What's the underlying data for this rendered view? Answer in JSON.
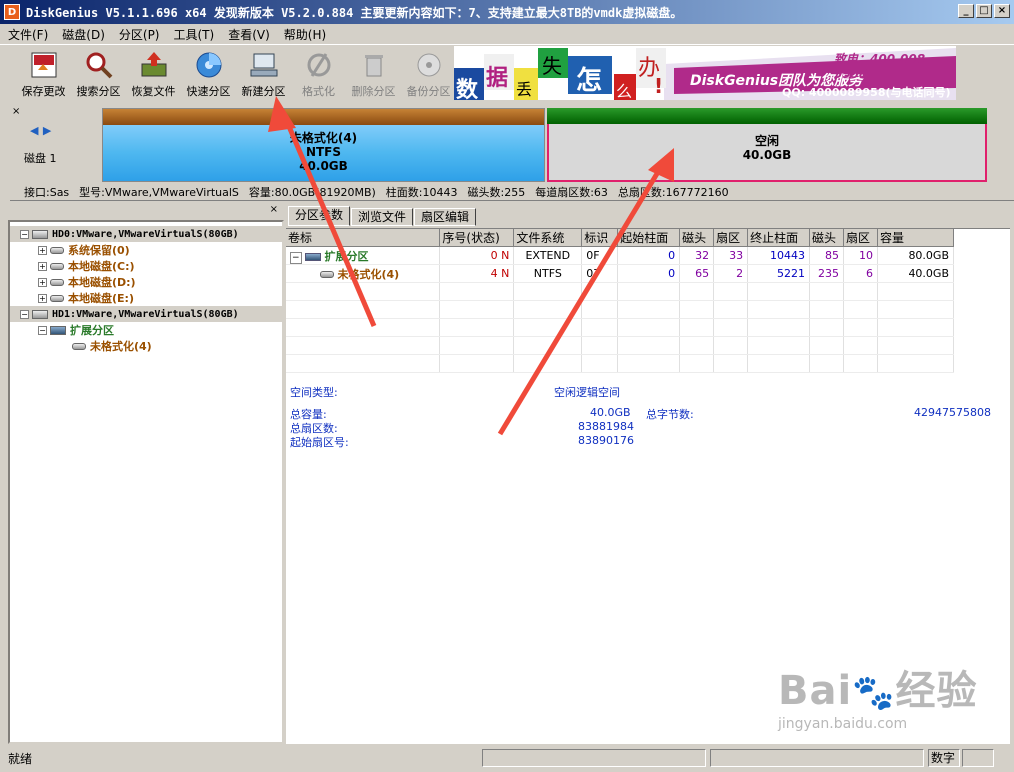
{
  "window": {
    "app_icon": "D",
    "title": "DiskGenius V5.1.1.696 x64   发现新版本 V5.2.0.884 主要更新内容如下：7、支持建立最大8TB的vmdk虚拟磁盘。",
    "buttons": [
      "_",
      "□",
      "×"
    ]
  },
  "menu": [
    "文件(F)",
    "磁盘(D)",
    "分区(P)",
    "工具(T)",
    "查看(V)",
    "帮助(H)"
  ],
  "toolbar": {
    "buttons": [
      {
        "label": "保存更改",
        "icon": "save-icon",
        "enabled": true
      },
      {
        "label": "搜索分区",
        "icon": "search-icon",
        "enabled": true
      },
      {
        "label": "恢复文件",
        "icon": "recover-icon",
        "enabled": true
      },
      {
        "label": "快速分区",
        "icon": "quick-partition-icon",
        "enabled": true
      },
      {
        "label": "新建分区",
        "icon": "new-partition-icon",
        "enabled": true
      },
      {
        "label": "格式化",
        "icon": "format-icon",
        "enabled": false
      },
      {
        "label": "删除分区",
        "icon": "trash-icon",
        "enabled": false
      },
      {
        "label": "备份分区",
        "icon": "backup-icon",
        "enabled": false
      }
    ]
  },
  "banner": {
    "chars": [
      "数",
      "据",
      "丢",
      "失",
      "怎",
      "么",
      "办"
    ],
    "exclaim": "!",
    "brand": "DiskGenius团队为您服务",
    "phone": "致电：400-008-9958",
    "qq": "QQ: 4000089958(与电话同号)"
  },
  "diskmap": {
    "close": "×",
    "disk_label": "磁盘 1",
    "nav_left": "◀",
    "nav_right": "▶",
    "part1": {
      "name": "未格式化(4)",
      "fs": "NTFS",
      "size": "40.0GB"
    },
    "part2": {
      "name": "空闲",
      "size": "40.0GB"
    }
  },
  "infobar": {
    "interface": "接口:Sas",
    "model": "型号:VMware,VMwareVirtualS",
    "capacity": "容量:80.0GB(81920MB)",
    "cylinders": "柱面数:10443",
    "heads": "磁头数:255",
    "sectors_per_track": "每道扇区数:63",
    "total_sectors": "总扇区数:167772160"
  },
  "tree": {
    "close": "×",
    "nodes": [
      {
        "level": 0,
        "toggle": "−",
        "label": "HD0:VMware,VMwareVirtualS(80GB)",
        "color": "black"
      },
      {
        "level": 1,
        "toggle": "+",
        "label": "系统保留(0)",
        "color": "brown"
      },
      {
        "level": 1,
        "toggle": "+",
        "label": "本地磁盘(C:)",
        "color": "brown"
      },
      {
        "level": 1,
        "toggle": "+",
        "label": "本地磁盘(D:)",
        "color": "brown"
      },
      {
        "level": 1,
        "toggle": "+",
        "label": "本地磁盘(E:)",
        "color": "brown"
      },
      {
        "level": 0,
        "toggle": "−",
        "label": "HD1:VMware,VMwareVirtualS(80GB)",
        "color": "black"
      },
      {
        "level": 1,
        "toggle": "−",
        "label": "扩展分区",
        "color": "green"
      },
      {
        "level": 2,
        "toggle": "",
        "label": "未格式化(4)",
        "color": "brown"
      }
    ]
  },
  "tabs": [
    "分区参数",
    "浏览文件",
    "扇区编辑"
  ],
  "table": {
    "headers": [
      "卷标",
      "序号(状态)",
      "文件系统",
      "标识",
      "起始柱面",
      "磁头",
      "扇区",
      "终止柱面",
      "磁头",
      "扇区",
      "容量"
    ],
    "rows": [
      {
        "name": "扩展分区",
        "seq": "0 N",
        "fs": "EXTEND",
        "id": "0F",
        "start_cyl": "0",
        "start_head": "32",
        "start_sec": "33",
        "end_cyl": "10443",
        "end_head": "85",
        "end_sec": "10",
        "size": "80.0GB"
      },
      {
        "name": "未格式化(4)",
        "seq": "4 N",
        "fs": "NTFS",
        "id": "07",
        "start_cyl": "0",
        "start_head": "65",
        "start_sec": "2",
        "end_cyl": "5221",
        "end_head": "235",
        "end_sec": "6",
        "size": "40.0GB"
      }
    ]
  },
  "details": {
    "type_label": "空间类型:",
    "type_value": "空闲逻辑空间",
    "total_cap_label": "总容量:",
    "total_cap_value": "40.0GB",
    "total_bytes_label": "总字节数:",
    "total_bytes_value": "42947575808",
    "total_sectors_label": "总扇区数:",
    "total_sectors_value": "83881984",
    "start_sector_label": "起始扇区号:",
    "start_sector_value": "83890176"
  },
  "status": {
    "text": "就绪",
    "numlock": "数字"
  },
  "watermark": {
    "logo": "Bai",
    "logo2": "经验",
    "url": "jingyan.baidu.com"
  },
  "colors": {
    "titlebar": "#0a246a",
    "free_border": "#e0206c",
    "arrow": "#f04a3a",
    "brown": "#9a5000",
    "green": "#2a7a2a"
  }
}
